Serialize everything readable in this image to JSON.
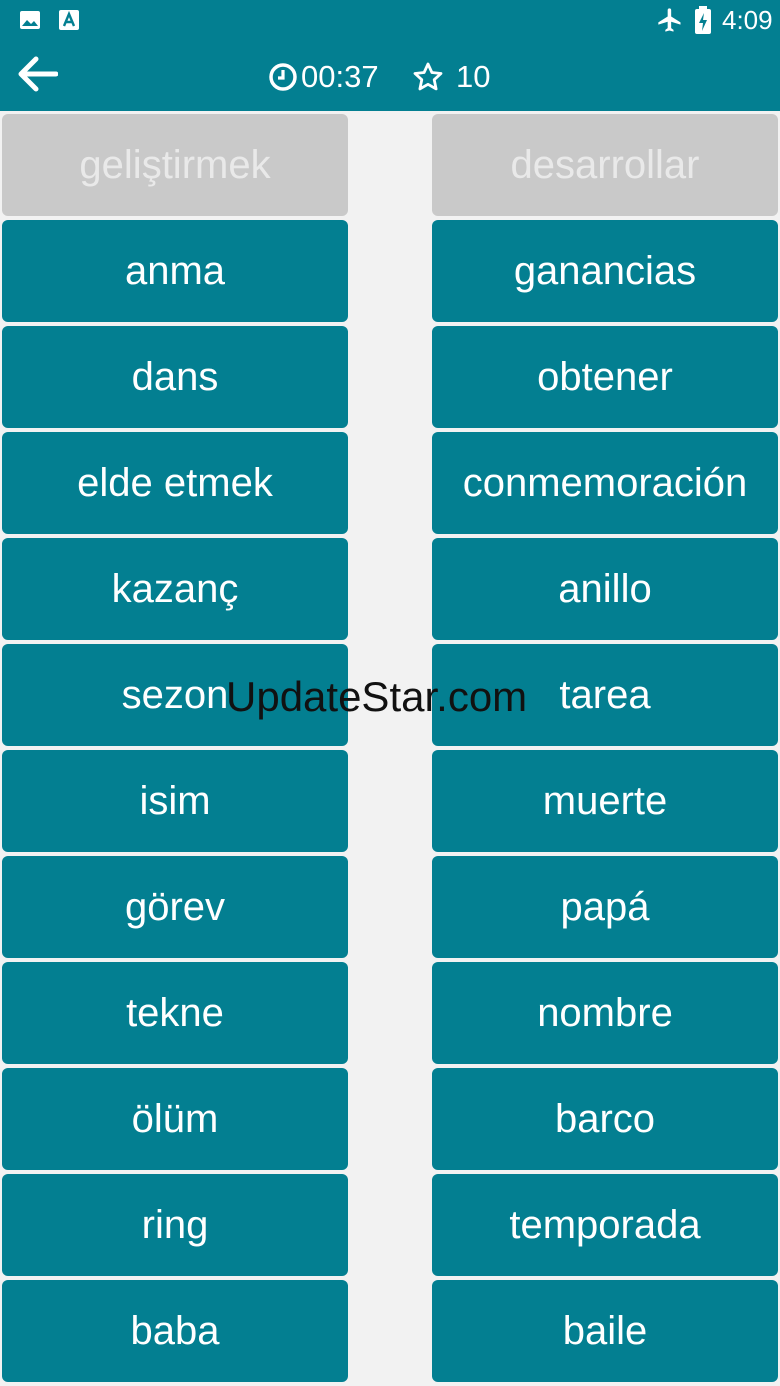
{
  "status_bar": {
    "time": "4:09",
    "icons": [
      "gallery-icon",
      "translate-a-icon",
      "airplane-mode-icon",
      "battery-charging-icon"
    ]
  },
  "app_bar": {
    "back_icon": "arrow-left-icon",
    "timer_icon": "clock-icon",
    "timer": "00:37",
    "score_icon": "star-outline-icon",
    "score": "10"
  },
  "colors": {
    "primary": "#037f91",
    "matched_tile": "#c9c9c9",
    "background": "#f2f2f2"
  },
  "matched": {
    "left": "geliştirmek",
    "right": "desarrollar"
  },
  "left_words": [
    "anma",
    "dans",
    "elde etmek",
    "kazanç",
    "sezon",
    "isim",
    "görev",
    "tekne",
    "ölüm",
    "ring",
    "baba"
  ],
  "right_words": [
    "ganancias",
    "obtener",
    "conmemoración",
    "anillo",
    "tarea",
    "muerte",
    "papá",
    "nombre",
    "barco",
    "temporada",
    "baile"
  ],
  "watermark": "UpdateStar.com"
}
